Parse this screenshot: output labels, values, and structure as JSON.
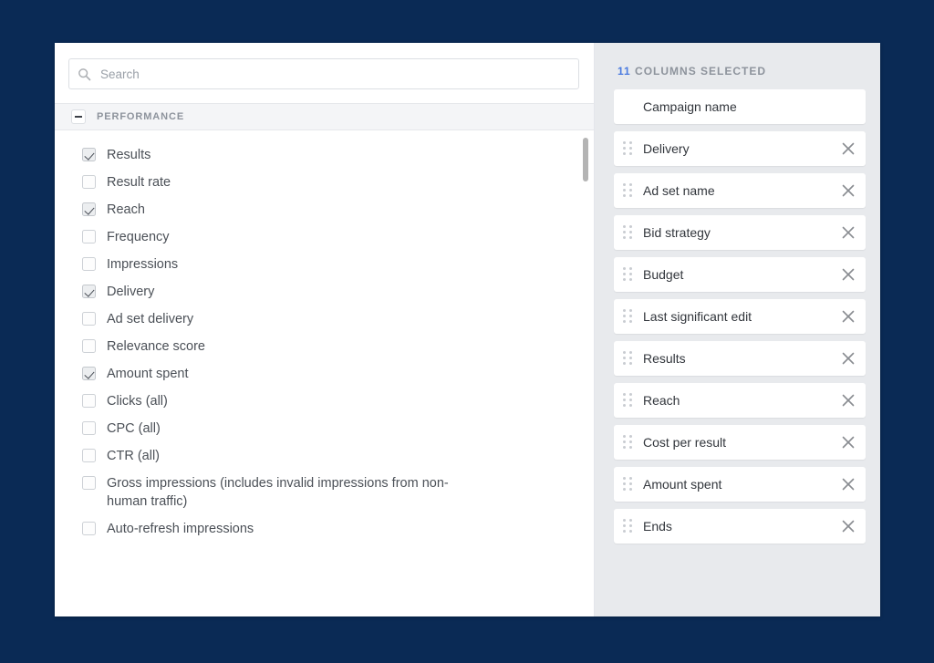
{
  "search": {
    "placeholder": "Search",
    "value": "",
    "icon": "search-icon"
  },
  "section": {
    "title": "PERFORMANCE",
    "collapse_icon": "minus-icon",
    "expanded": true
  },
  "metrics": [
    {
      "label": "Results",
      "checked": true
    },
    {
      "label": "Result rate",
      "checked": false
    },
    {
      "label": "Reach",
      "checked": true
    },
    {
      "label": "Frequency",
      "checked": false
    },
    {
      "label": "Impressions",
      "checked": false
    },
    {
      "label": "Delivery",
      "checked": true
    },
    {
      "label": "Ad set delivery",
      "checked": false
    },
    {
      "label": "Relevance score",
      "checked": false
    },
    {
      "label": "Amount spent",
      "checked": true
    },
    {
      "label": "Clicks (all)",
      "checked": false
    },
    {
      "label": "CPC (all)",
      "checked": false
    },
    {
      "label": "CTR (all)",
      "checked": false
    },
    {
      "label": "Gross impressions (includes invalid impressions from non-human traffic)",
      "checked": false
    },
    {
      "label": "Auto-refresh impressions",
      "checked": false
    }
  ],
  "selected_panel": {
    "count": "11",
    "heading": "COLUMNS SELECTED",
    "accent_color": "#4a7ae0",
    "items": [
      {
        "label": "Campaign name",
        "draggable": false,
        "removable": false
      },
      {
        "label": "Delivery",
        "draggable": true,
        "removable": true
      },
      {
        "label": "Ad set name",
        "draggable": true,
        "removable": true
      },
      {
        "label": "Bid strategy",
        "draggable": true,
        "removable": true
      },
      {
        "label": "Budget",
        "draggable": true,
        "removable": true
      },
      {
        "label": "Last significant edit",
        "draggable": true,
        "removable": true
      },
      {
        "label": "Results",
        "draggable": true,
        "removable": true
      },
      {
        "label": "Reach",
        "draggable": true,
        "removable": true
      },
      {
        "label": "Cost per result",
        "draggable": true,
        "removable": true
      },
      {
        "label": "Amount spent",
        "draggable": true,
        "removable": true
      },
      {
        "label": "Ends",
        "draggable": true,
        "removable": true
      }
    ]
  },
  "theme": {
    "backdrop": "#0a2a55",
    "panel_bg": "#ffffff",
    "right_bg": "#e8eaed"
  }
}
